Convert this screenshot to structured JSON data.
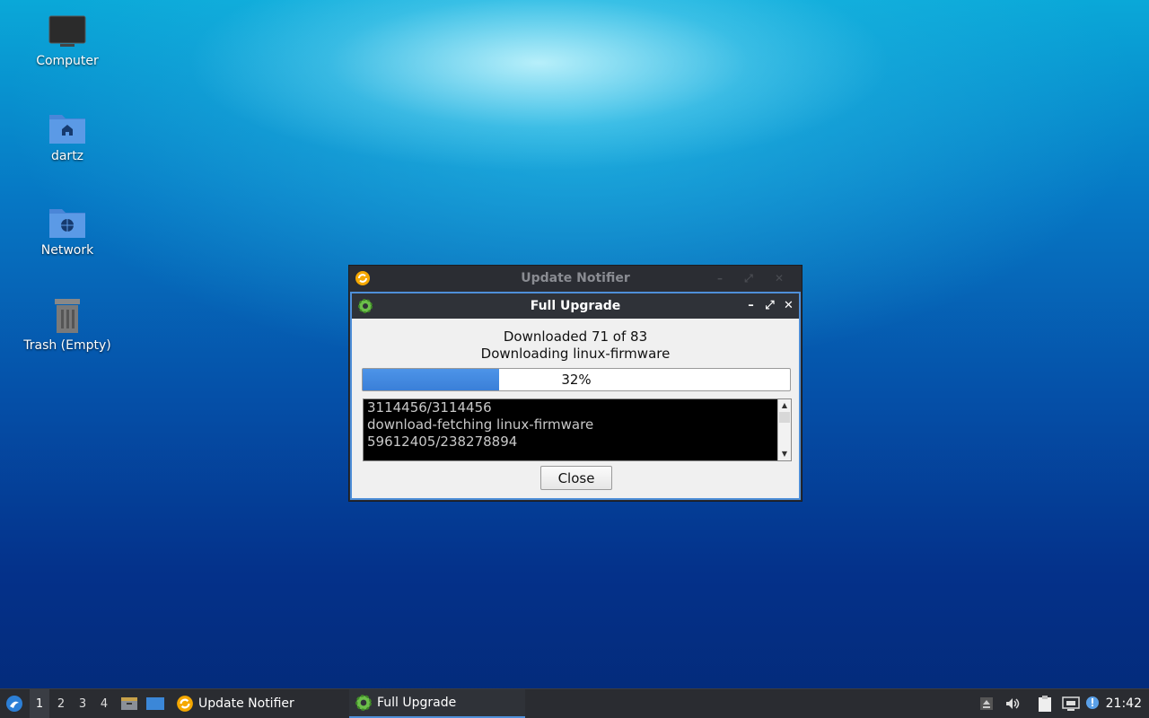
{
  "desktop": {
    "icons": [
      {
        "label": "Computer"
      },
      {
        "label": "dartz"
      },
      {
        "label": "Network"
      },
      {
        "label": "Trash (Empty)"
      }
    ]
  },
  "back_window": {
    "title": "Update Notifier"
  },
  "upgrade_window": {
    "title": "Full Upgrade",
    "status_line1": "Downloaded 71 of 83",
    "status_line2": "Downloading linux-firmware",
    "progress_percent": 32,
    "progress_text": "32%",
    "log_lines": [
      "3114456/3114456",
      "download-fetching linux-firmware",
      "59612405/238278894"
    ],
    "close_label": "Close",
    "controls": {
      "minimize": "–",
      "maximize": "⤢",
      "close": "✕"
    }
  },
  "taskbar": {
    "workspaces": [
      "1",
      "2",
      "3",
      "4"
    ],
    "active_workspace": "1",
    "tasks": [
      {
        "label": "Update Notifier",
        "icon": "update-notifier-icon"
      },
      {
        "label": "Full Upgrade",
        "icon": "gear-icon"
      }
    ],
    "clock": "21:42"
  },
  "colors": {
    "accent": "#4f8fd8",
    "titlebar": "#2f3238",
    "taskbar": "#2a2c31"
  }
}
